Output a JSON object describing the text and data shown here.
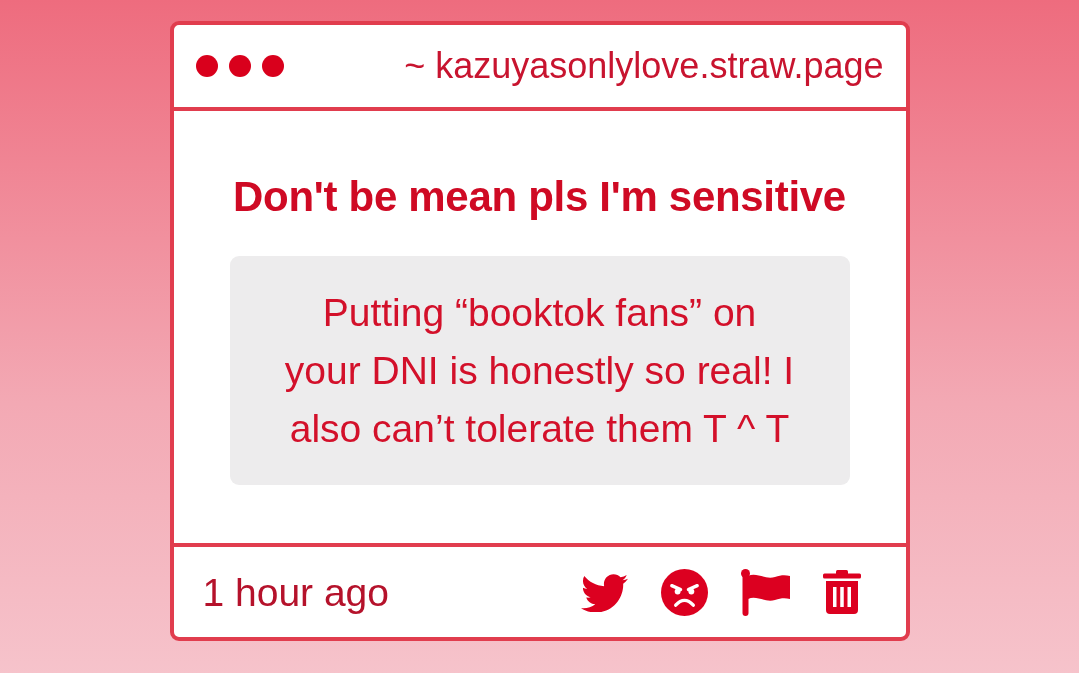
{
  "window": {
    "address": "~ kazuyasonlylove.straw.page"
  },
  "post": {
    "title": "Don't be mean pls I'm sensitive",
    "message": "Putting “booktok fans” on your DNI is honestly so real! I also can’t tolerate them T ^ T"
  },
  "footer": {
    "time": "1 hour ago"
  }
}
